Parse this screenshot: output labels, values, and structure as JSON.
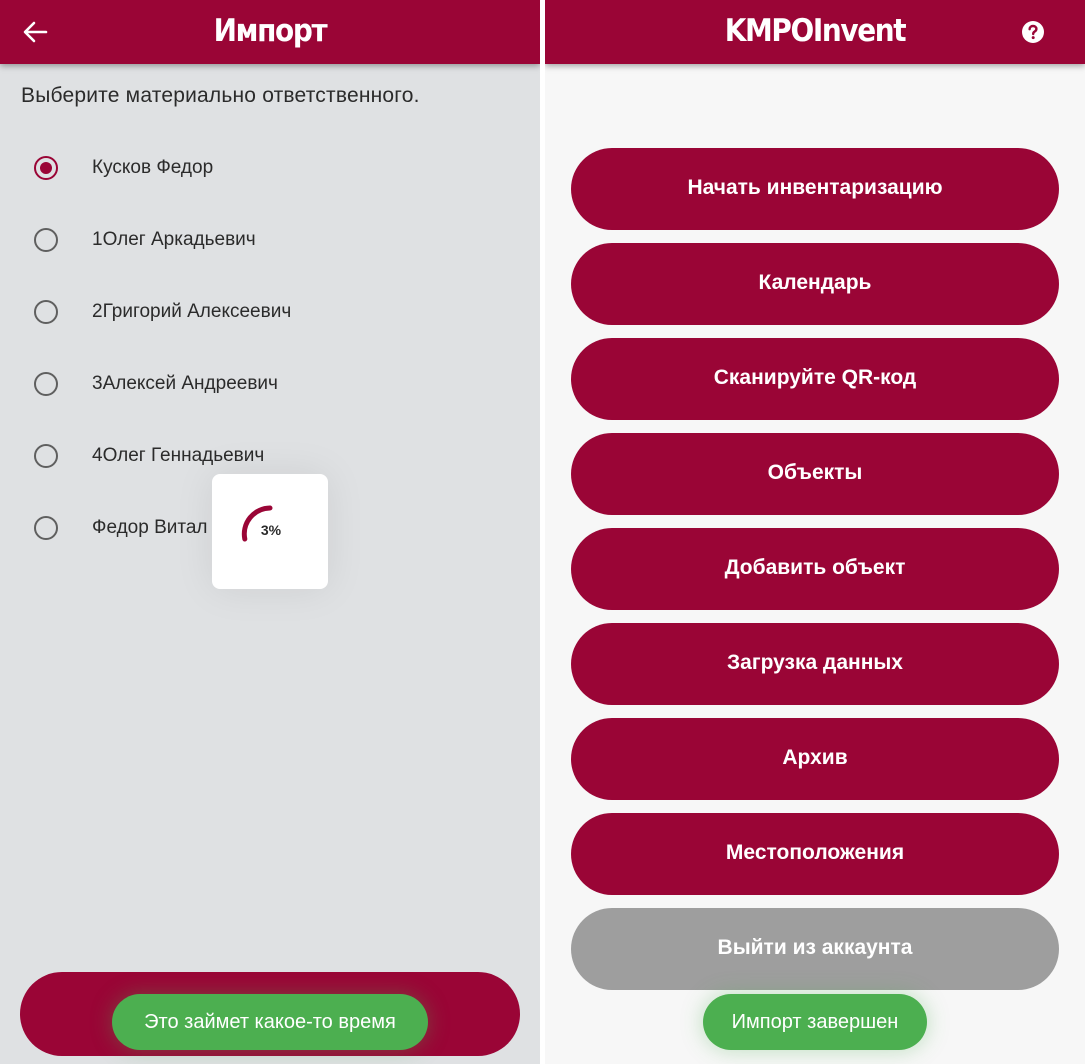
{
  "left_screen": {
    "title": "Импорт",
    "prompt": "Выберите материально ответственного.",
    "options": [
      {
        "label": "Кусков Федор",
        "checked": true
      },
      {
        "label": "1Олег Аркадьевич",
        "checked": false
      },
      {
        "label": "2Григорий Алексеевич",
        "checked": false
      },
      {
        "label": "3Алексей Андреевич",
        "checked": false
      },
      {
        "label": "4Олег Геннадьевич",
        "checked": false
      },
      {
        "label": "Федор Витал",
        "checked": false
      }
    ],
    "progress_text": "3%",
    "progress_value": 0.03,
    "toast": "Это займет какое-то время"
  },
  "right_screen": {
    "title": "KMPOInvent",
    "buttons": [
      "Начать инвентаризацию",
      "Календарь",
      "Сканируйте QR-код",
      "Объекты",
      "Добавить объект",
      "Загрузка данных",
      "Архив",
      "Местоположения"
    ],
    "logout_button": "Выйти из аккаунта",
    "toast": "Импорт завершен"
  },
  "colors": {
    "primary": "#9a0536",
    "left_background": "#dfe1e3",
    "right_background": "#f7f7f7",
    "toast_green": "#4caf50",
    "logout_grey": "#9e9e9e"
  },
  "icons": {
    "back": "arrow-left",
    "help": "question-circle",
    "radio_checked": "radio-checked",
    "radio_unchecked": "radio-unchecked",
    "progress": "circular-progress"
  }
}
